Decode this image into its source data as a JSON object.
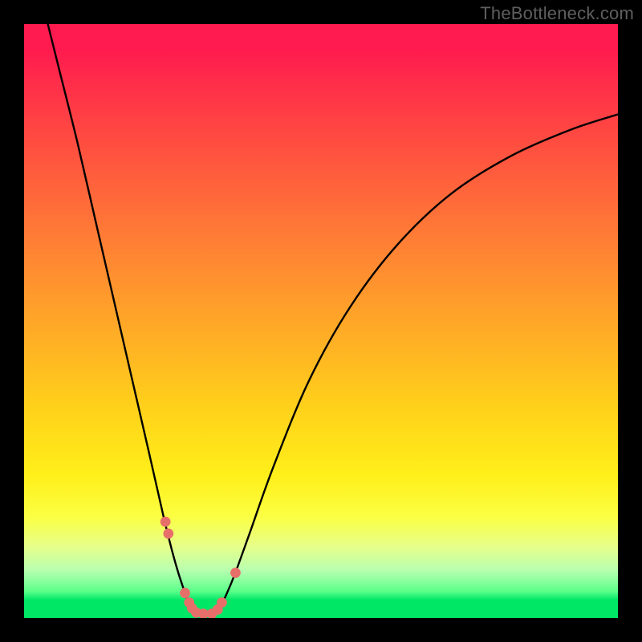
{
  "watermark": "TheBottleneck.com",
  "chart_data": {
    "type": "line",
    "title": "",
    "xlabel": "",
    "ylabel": "",
    "xlim": [
      0,
      100
    ],
    "ylim": [
      0,
      100
    ],
    "series": [
      {
        "name": "curve",
        "x": [
          4,
          6,
          9,
          12,
          15,
          18,
          21,
          23.5,
          25,
          26,
          27,
          27.8,
          28.6,
          30.5,
          32,
          33,
          34,
          35.5,
          38,
          42,
          48,
          55,
          63,
          72,
          82,
          92,
          100
        ],
        "y": [
          100,
          92,
          80,
          67,
          54,
          41,
          28,
          17,
          11,
          7.5,
          4.5,
          2.2,
          0.6,
          0.6,
          0.6,
          1.8,
          3.8,
          7.4,
          14.3,
          25.5,
          40,
          52.5,
          63,
          71.5,
          77.8,
          82.2,
          84.8
        ]
      }
    ],
    "markers": [
      {
        "x": 23.8,
        "y": 16.2
      },
      {
        "x": 24.3,
        "y": 14.2
      },
      {
        "x": 27.1,
        "y": 4.2
      },
      {
        "x": 27.8,
        "y": 2.6
      },
      {
        "x": 28.3,
        "y": 1.6
      },
      {
        "x": 29.0,
        "y": 0.9
      },
      {
        "x": 30.2,
        "y": 0.7
      },
      {
        "x": 31.6,
        "y": 0.7
      },
      {
        "x": 32.6,
        "y": 1.4
      },
      {
        "x": 33.3,
        "y": 2.6
      },
      {
        "x": 35.6,
        "y": 7.6
      }
    ],
    "gradient_stops": [
      {
        "pos": 0,
        "color": "#ff1a4f"
      },
      {
        "pos": 0.04,
        "color": "#ff1a4f"
      },
      {
        "pos": 0.18,
        "color": "#ff4742"
      },
      {
        "pos": 0.35,
        "color": "#ff7a36"
      },
      {
        "pos": 0.5,
        "color": "#ffa628"
      },
      {
        "pos": 0.65,
        "color": "#ffd21a"
      },
      {
        "pos": 0.76,
        "color": "#ffef1a"
      },
      {
        "pos": 0.83,
        "color": "#fbff43"
      },
      {
        "pos": 0.88,
        "color": "#e6ff8a"
      },
      {
        "pos": 0.92,
        "color": "#b8ffb0"
      },
      {
        "pos": 0.955,
        "color": "#5cff8a"
      },
      {
        "pos": 0.97,
        "color": "#00e765"
      },
      {
        "pos": 1.0,
        "color": "#00e765"
      }
    ]
  }
}
